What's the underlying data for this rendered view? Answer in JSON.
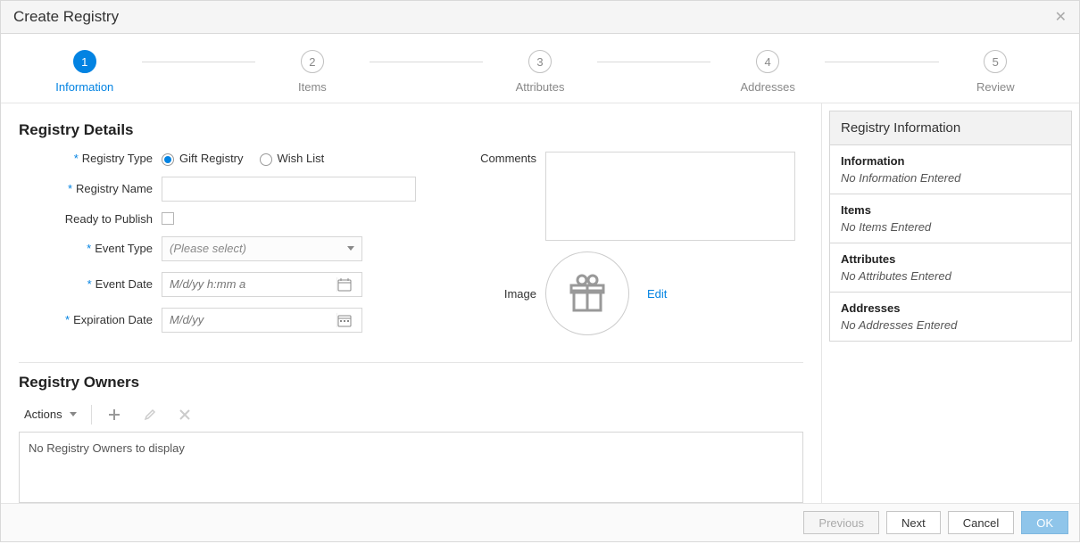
{
  "header": {
    "title": "Create Registry"
  },
  "steps": [
    {
      "num": "1",
      "label": "Information"
    },
    {
      "num": "2",
      "label": "Items"
    },
    {
      "num": "3",
      "label": "Attributes"
    },
    {
      "num": "4",
      "label": "Addresses"
    },
    {
      "num": "5",
      "label": "Review"
    }
  ],
  "section": {
    "details_title": "Registry Details",
    "owners_title": "Registry Owners"
  },
  "form": {
    "registry_type_label": "Registry Type",
    "registry_type_options": {
      "gift": "Gift Registry",
      "wish": "Wish List"
    },
    "registry_name_label": "Registry Name",
    "registry_name_value": "",
    "ready_to_publish_label": "Ready to Publish",
    "event_type_label": "Event Type",
    "event_type_placeholder": "(Please select)",
    "event_date_label": "Event Date",
    "event_date_placeholder": "M/d/yy h:mm a",
    "expiration_date_label": "Expiration Date",
    "expiration_date_placeholder": "M/d/yy",
    "comments_label": "Comments",
    "comments_value": "",
    "image_label": "Image",
    "edit_label": "Edit"
  },
  "owners": {
    "actions_label": "Actions",
    "empty_text": "No Registry Owners to display"
  },
  "sidebar": {
    "title": "Registry Information",
    "sections": [
      {
        "title": "Information",
        "value": "No Information Entered"
      },
      {
        "title": "Items",
        "value": "No Items Entered"
      },
      {
        "title": "Attributes",
        "value": "No Attributes Entered"
      },
      {
        "title": "Addresses",
        "value": "No Addresses Entered"
      }
    ]
  },
  "footer": {
    "previous": "Previous",
    "next": "Next",
    "cancel": "Cancel",
    "ok": "OK"
  }
}
